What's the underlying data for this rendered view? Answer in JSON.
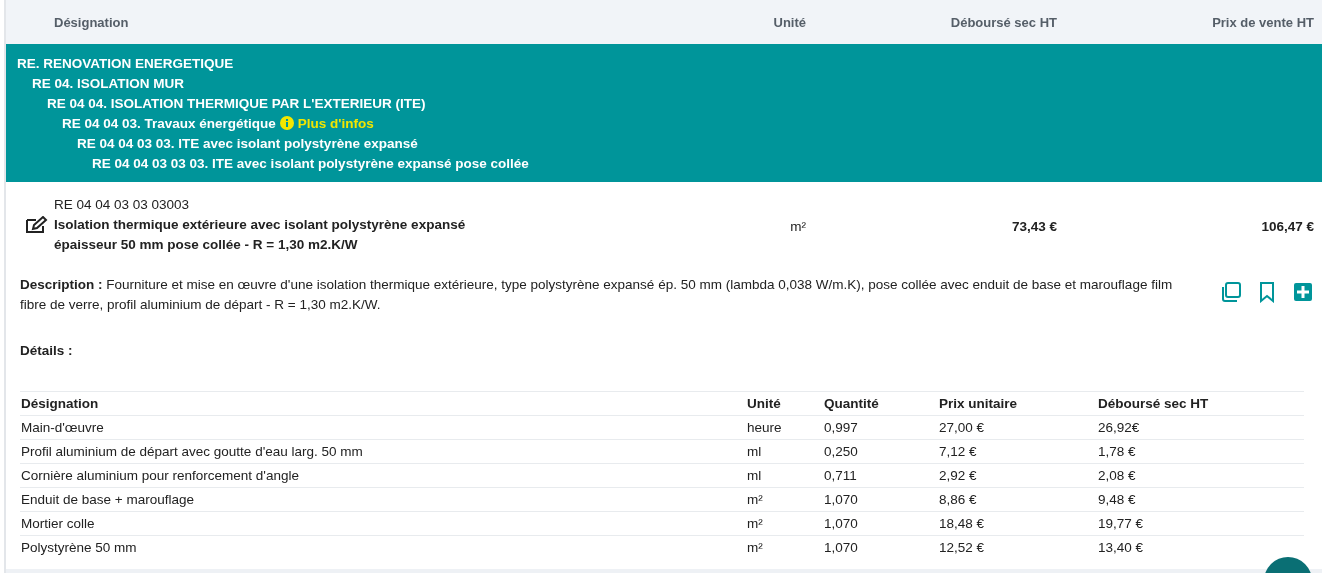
{
  "columns": [
    "Désignation",
    "Unité",
    "Déboursé sec HT",
    "Prix de vente HT"
  ],
  "categories": [
    {
      "label": "RE. RENOVATION ENERGETIQUE",
      "children": [
        {
          "label": "RE 04. ISOLATION MUR",
          "children": [
            {
              "label": "RE 04 04. ISOLATION THERMIQUE PAR L'EXTERIEUR (ITE)",
              "children": [
                {
                  "label": "RE 04 04 03. Travaux énergétique",
                  "info_link": "Plus d'infos",
                  "children": [
                    {
                      "label": "RE 04 04 03 03. ITE avec isolant polystyrène expansé",
                      "children": [
                        {
                          "label": "RE 04 04 03 03 03. ITE avec isolant polystyrène expansé pose collée"
                        }
                      ]
                    }
                  ]
                }
              ]
            }
          ]
        }
      ]
    }
  ],
  "item": {
    "code": "RE 04 04 03 03 03003",
    "title": "Isolation thermique extérieure avec isolant polystyrène expansé épaisseur 50 mm pose collée - R = 1,30 m2.K/W",
    "unit": "m²",
    "cost": "73,43 €",
    "price": "106,47 €"
  },
  "description": {
    "label": "Description :",
    "text": "Fourniture et mise en œuvre d'une isolation thermique extérieure, type polystyrène expansé ép. 50 mm (lambda 0,038 W/m.K), pose collée avec enduit de base et marouflage film fibre de verre, profil aluminium de départ - R = 1,30 m2.K/W."
  },
  "details": {
    "label": "Détails :",
    "columns": [
      "Désignation",
      "Unité",
      "Quantité",
      "Prix unitaire",
      "Déboursé sec HT"
    ],
    "rows": [
      [
        "Main-d'œuvre",
        "heure",
        "0,997",
        "27,00 €",
        "26,92€"
      ],
      [
        "Profil aluminium de départ avec goutte d'eau larg. 50 mm",
        "ml",
        "0,250",
        "7,12 €",
        "1,78 €"
      ],
      [
        "Cornière aluminium pour renforcement d'angle",
        "ml",
        "0,711",
        "2,92 €",
        "2,08 €"
      ],
      [
        "Enduit de base + marouflage",
        "m²",
        "1,070",
        "8,86 €",
        "9,48 €"
      ],
      [
        "Mortier colle",
        "m²",
        "1,070",
        "18,48 €",
        "19,77 €"
      ],
      [
        "Polystyrène 50 mm",
        "m²",
        "1,070",
        "12,52 €",
        "13,40 €"
      ]
    ]
  }
}
